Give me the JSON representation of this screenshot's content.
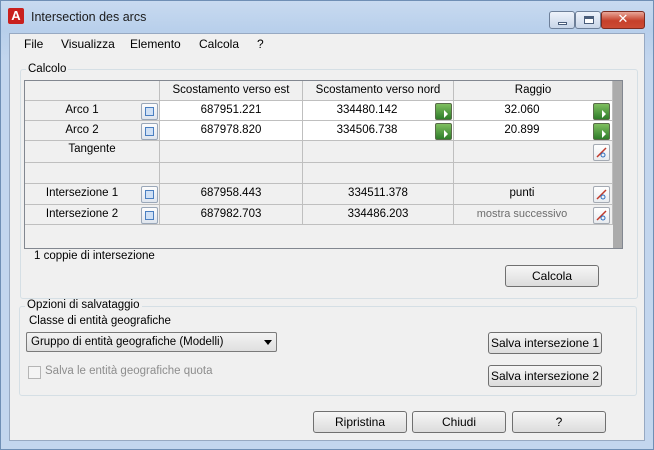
{
  "window": {
    "title": "Intersection des arcs",
    "app_icon_letter": "A",
    "close_glyph": "✕"
  },
  "menu": [
    "File",
    "Visualizza",
    "Elemento",
    "Calcola",
    "?"
  ],
  "calc_group": {
    "label": "Calcolo",
    "columns": [
      "",
      "Scostamento verso est",
      "Scostamento verso nord",
      "Raggio"
    ],
    "rows": [
      {
        "label": "Arco 1",
        "east": "687951.221",
        "north": "334480.142",
        "radius": "32.060"
      },
      {
        "label": "Arco 2",
        "east": "687978.820",
        "north": "334506.738",
        "radius": "20.899"
      },
      {
        "label": "Tangente",
        "east": "",
        "north": "",
        "radius": ""
      },
      {
        "label": "",
        "east": "",
        "north": "",
        "radius": ""
      },
      {
        "label": "Intersezione 1",
        "east": "687958.443",
        "north": "334511.378",
        "radius": "punti"
      },
      {
        "label": "Intersezione 2",
        "east": "687982.703",
        "north": "334486.203",
        "radius": "mostra successivo"
      }
    ],
    "pairs_text": "1 coppie di intersezione",
    "calc_button": "Calcola"
  },
  "save_group": {
    "label": "Opzioni di salvataggio",
    "class_label": "Classe di entità geografiche",
    "class_selected": "Gruppo di entità geografiche (Modelli)",
    "elevation_checkbox": "Salva le entità geografiche quota",
    "elevation_checked": false,
    "save1_button": "Salva intersezione 1",
    "save2_button": "Salva intersezione 2"
  },
  "footer": {
    "reset_button": "Ripristina",
    "close_button": "Chiudi",
    "help_button": "?"
  },
  "colors": {
    "title_gradient": "#c8daf0",
    "dialog_bg": "#f0f0f0",
    "close_button": "#c6402b"
  }
}
